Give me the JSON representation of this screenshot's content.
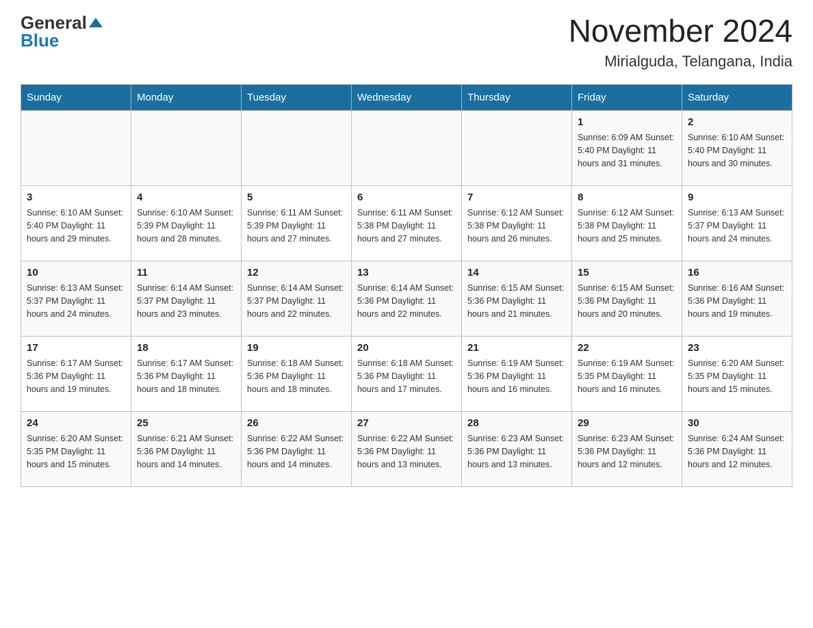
{
  "logo": {
    "general": "General",
    "blue": "Blue"
  },
  "title": "November 2024",
  "location": "Mirialguda, Telangana, India",
  "weekdays": [
    "Sunday",
    "Monday",
    "Tuesday",
    "Wednesday",
    "Thursday",
    "Friday",
    "Saturday"
  ],
  "weeks": [
    [
      {
        "day": "",
        "info": ""
      },
      {
        "day": "",
        "info": ""
      },
      {
        "day": "",
        "info": ""
      },
      {
        "day": "",
        "info": ""
      },
      {
        "day": "",
        "info": ""
      },
      {
        "day": "1",
        "info": "Sunrise: 6:09 AM\nSunset: 5:40 PM\nDaylight: 11 hours\nand 31 minutes."
      },
      {
        "day": "2",
        "info": "Sunrise: 6:10 AM\nSunset: 5:40 PM\nDaylight: 11 hours\nand 30 minutes."
      }
    ],
    [
      {
        "day": "3",
        "info": "Sunrise: 6:10 AM\nSunset: 5:40 PM\nDaylight: 11 hours\nand 29 minutes."
      },
      {
        "day": "4",
        "info": "Sunrise: 6:10 AM\nSunset: 5:39 PM\nDaylight: 11 hours\nand 28 minutes."
      },
      {
        "day": "5",
        "info": "Sunrise: 6:11 AM\nSunset: 5:39 PM\nDaylight: 11 hours\nand 27 minutes."
      },
      {
        "day": "6",
        "info": "Sunrise: 6:11 AM\nSunset: 5:38 PM\nDaylight: 11 hours\nand 27 minutes."
      },
      {
        "day": "7",
        "info": "Sunrise: 6:12 AM\nSunset: 5:38 PM\nDaylight: 11 hours\nand 26 minutes."
      },
      {
        "day": "8",
        "info": "Sunrise: 6:12 AM\nSunset: 5:38 PM\nDaylight: 11 hours\nand 25 minutes."
      },
      {
        "day": "9",
        "info": "Sunrise: 6:13 AM\nSunset: 5:37 PM\nDaylight: 11 hours\nand 24 minutes."
      }
    ],
    [
      {
        "day": "10",
        "info": "Sunrise: 6:13 AM\nSunset: 5:37 PM\nDaylight: 11 hours\nand 24 minutes."
      },
      {
        "day": "11",
        "info": "Sunrise: 6:14 AM\nSunset: 5:37 PM\nDaylight: 11 hours\nand 23 minutes."
      },
      {
        "day": "12",
        "info": "Sunrise: 6:14 AM\nSunset: 5:37 PM\nDaylight: 11 hours\nand 22 minutes."
      },
      {
        "day": "13",
        "info": "Sunrise: 6:14 AM\nSunset: 5:36 PM\nDaylight: 11 hours\nand 22 minutes."
      },
      {
        "day": "14",
        "info": "Sunrise: 6:15 AM\nSunset: 5:36 PM\nDaylight: 11 hours\nand 21 minutes."
      },
      {
        "day": "15",
        "info": "Sunrise: 6:15 AM\nSunset: 5:36 PM\nDaylight: 11 hours\nand 20 minutes."
      },
      {
        "day": "16",
        "info": "Sunrise: 6:16 AM\nSunset: 5:36 PM\nDaylight: 11 hours\nand 19 minutes."
      }
    ],
    [
      {
        "day": "17",
        "info": "Sunrise: 6:17 AM\nSunset: 5:36 PM\nDaylight: 11 hours\nand 19 minutes."
      },
      {
        "day": "18",
        "info": "Sunrise: 6:17 AM\nSunset: 5:36 PM\nDaylight: 11 hours\nand 18 minutes."
      },
      {
        "day": "19",
        "info": "Sunrise: 6:18 AM\nSunset: 5:36 PM\nDaylight: 11 hours\nand 18 minutes."
      },
      {
        "day": "20",
        "info": "Sunrise: 6:18 AM\nSunset: 5:36 PM\nDaylight: 11 hours\nand 17 minutes."
      },
      {
        "day": "21",
        "info": "Sunrise: 6:19 AM\nSunset: 5:36 PM\nDaylight: 11 hours\nand 16 minutes."
      },
      {
        "day": "22",
        "info": "Sunrise: 6:19 AM\nSunset: 5:35 PM\nDaylight: 11 hours\nand 16 minutes."
      },
      {
        "day": "23",
        "info": "Sunrise: 6:20 AM\nSunset: 5:35 PM\nDaylight: 11 hours\nand 15 minutes."
      }
    ],
    [
      {
        "day": "24",
        "info": "Sunrise: 6:20 AM\nSunset: 5:35 PM\nDaylight: 11 hours\nand 15 minutes."
      },
      {
        "day": "25",
        "info": "Sunrise: 6:21 AM\nSunset: 5:36 PM\nDaylight: 11 hours\nand 14 minutes."
      },
      {
        "day": "26",
        "info": "Sunrise: 6:22 AM\nSunset: 5:36 PM\nDaylight: 11 hours\nand 14 minutes."
      },
      {
        "day": "27",
        "info": "Sunrise: 6:22 AM\nSunset: 5:36 PM\nDaylight: 11 hours\nand 13 minutes."
      },
      {
        "day": "28",
        "info": "Sunrise: 6:23 AM\nSunset: 5:36 PM\nDaylight: 11 hours\nand 13 minutes."
      },
      {
        "day": "29",
        "info": "Sunrise: 6:23 AM\nSunset: 5:36 PM\nDaylight: 11 hours\nand 12 minutes."
      },
      {
        "day": "30",
        "info": "Sunrise: 6:24 AM\nSunset: 5:36 PM\nDaylight: 11 hours\nand 12 minutes."
      }
    ]
  ]
}
